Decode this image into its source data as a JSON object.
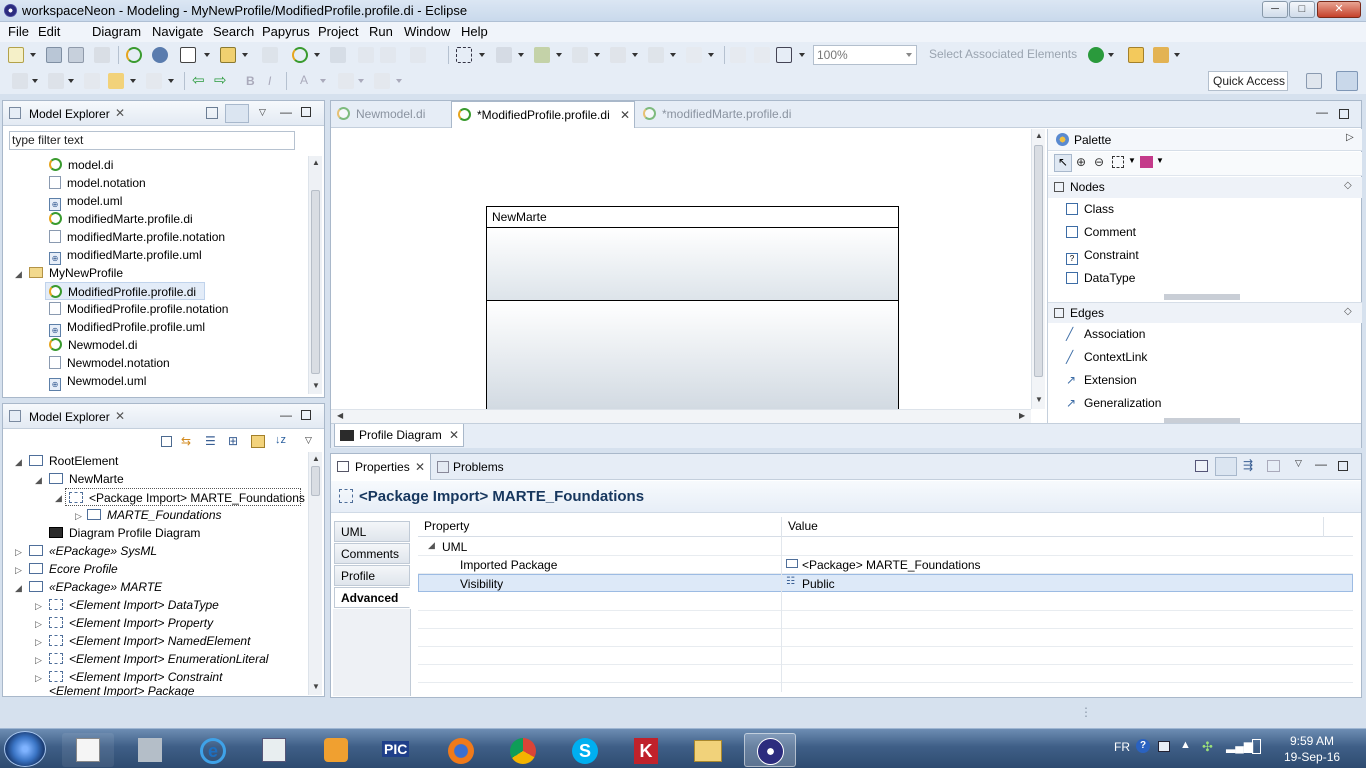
{
  "window": {
    "title": "workspaceNeon - Modeling - MyNewProfile/ModifiedProfile.profile.di - Eclipse",
    "min_label": "─",
    "max_label": "□",
    "close_label": "✕"
  },
  "menu": [
    "File",
    "Edit",
    "Diagram",
    "Navigate",
    "Search",
    "Papyrus",
    "Project",
    "Run",
    "Window",
    "Help"
  ],
  "toolbar": {
    "zoom_value": "100%",
    "select_associated": "Select Associated Elements",
    "quick_access": "Quick Access"
  },
  "model_explorer_top": {
    "title": "Model Explorer",
    "filter_placeholder": "type filter text",
    "items": [
      {
        "label": "model.di",
        "icon": "di"
      },
      {
        "label": "model.notation",
        "icon": "file"
      },
      {
        "label": "model.uml",
        "icon": "uml"
      },
      {
        "label": "modifiedMarte.profile.di",
        "icon": "di"
      },
      {
        "label": "modifiedMarte.profile.notation",
        "icon": "file"
      },
      {
        "label": "modifiedMarte.profile.uml",
        "icon": "uml"
      },
      {
        "label": "MyNewProfile",
        "icon": "folder"
      },
      {
        "label": "ModifiedProfile.profile.di",
        "icon": "di"
      },
      {
        "label": "ModifiedProfile.profile.notation",
        "icon": "file"
      },
      {
        "label": "ModifiedProfile.profile.uml",
        "icon": "uml"
      },
      {
        "label": "Newmodel.di",
        "icon": "di"
      },
      {
        "label": "Newmodel.notation",
        "icon": "file"
      },
      {
        "label": "Newmodel.uml",
        "icon": "uml"
      }
    ]
  },
  "model_explorer_bottom": {
    "title": "Model Explorer",
    "items": [
      {
        "label": "RootElement"
      },
      {
        "label": "NewMarte"
      },
      {
        "label": "<Package Import> MARTE_Foundations"
      },
      {
        "label": "MARTE_Foundations"
      },
      {
        "label": "Diagram Profile Diagram"
      },
      {
        "label": "«EPackage» SysML"
      },
      {
        "label": "Ecore Profile"
      },
      {
        "label": "«EPackage» MARTE"
      },
      {
        "label": "<Element Import> DataType"
      },
      {
        "label": "<Element Import> Property"
      },
      {
        "label": "<Element Import> NamedElement"
      },
      {
        "label": "<Element Import> EnumerationLiteral"
      },
      {
        "label": "<Element Import> Constraint"
      },
      {
        "label": "<Element Import> Package"
      }
    ]
  },
  "editor": {
    "tabs": [
      "Newmodel.di",
      "*ModifiedProfile.profile.di",
      "*modifiedMarte.profile.di"
    ],
    "package_name": "NewMarte",
    "bottom_tab": "Profile Diagram"
  },
  "palette": {
    "title": "Palette",
    "nodes_title": "Nodes",
    "nodes": [
      "Class",
      "Comment",
      "Constraint",
      "DataType"
    ],
    "edges_title": "Edges",
    "edges": [
      "Association",
      "ContextLink",
      "Extension",
      "Generalization"
    ]
  },
  "properties": {
    "tabs": [
      "Properties",
      "Problems"
    ],
    "header": "<Package Import> MARTE_Foundations",
    "side_tabs": [
      "UML",
      "Comments",
      "Profile",
      "Advanced"
    ],
    "col_property": "Property",
    "col_value": "Value",
    "group": "UML",
    "rows": [
      {
        "property": "Imported Package",
        "value": "<Package> MARTE_Foundations"
      },
      {
        "property": "Visibility",
        "value": "Public"
      }
    ]
  },
  "taskbar": {
    "lang": "FR",
    "time": "9:59 AM",
    "date": "19-Sep-16"
  }
}
